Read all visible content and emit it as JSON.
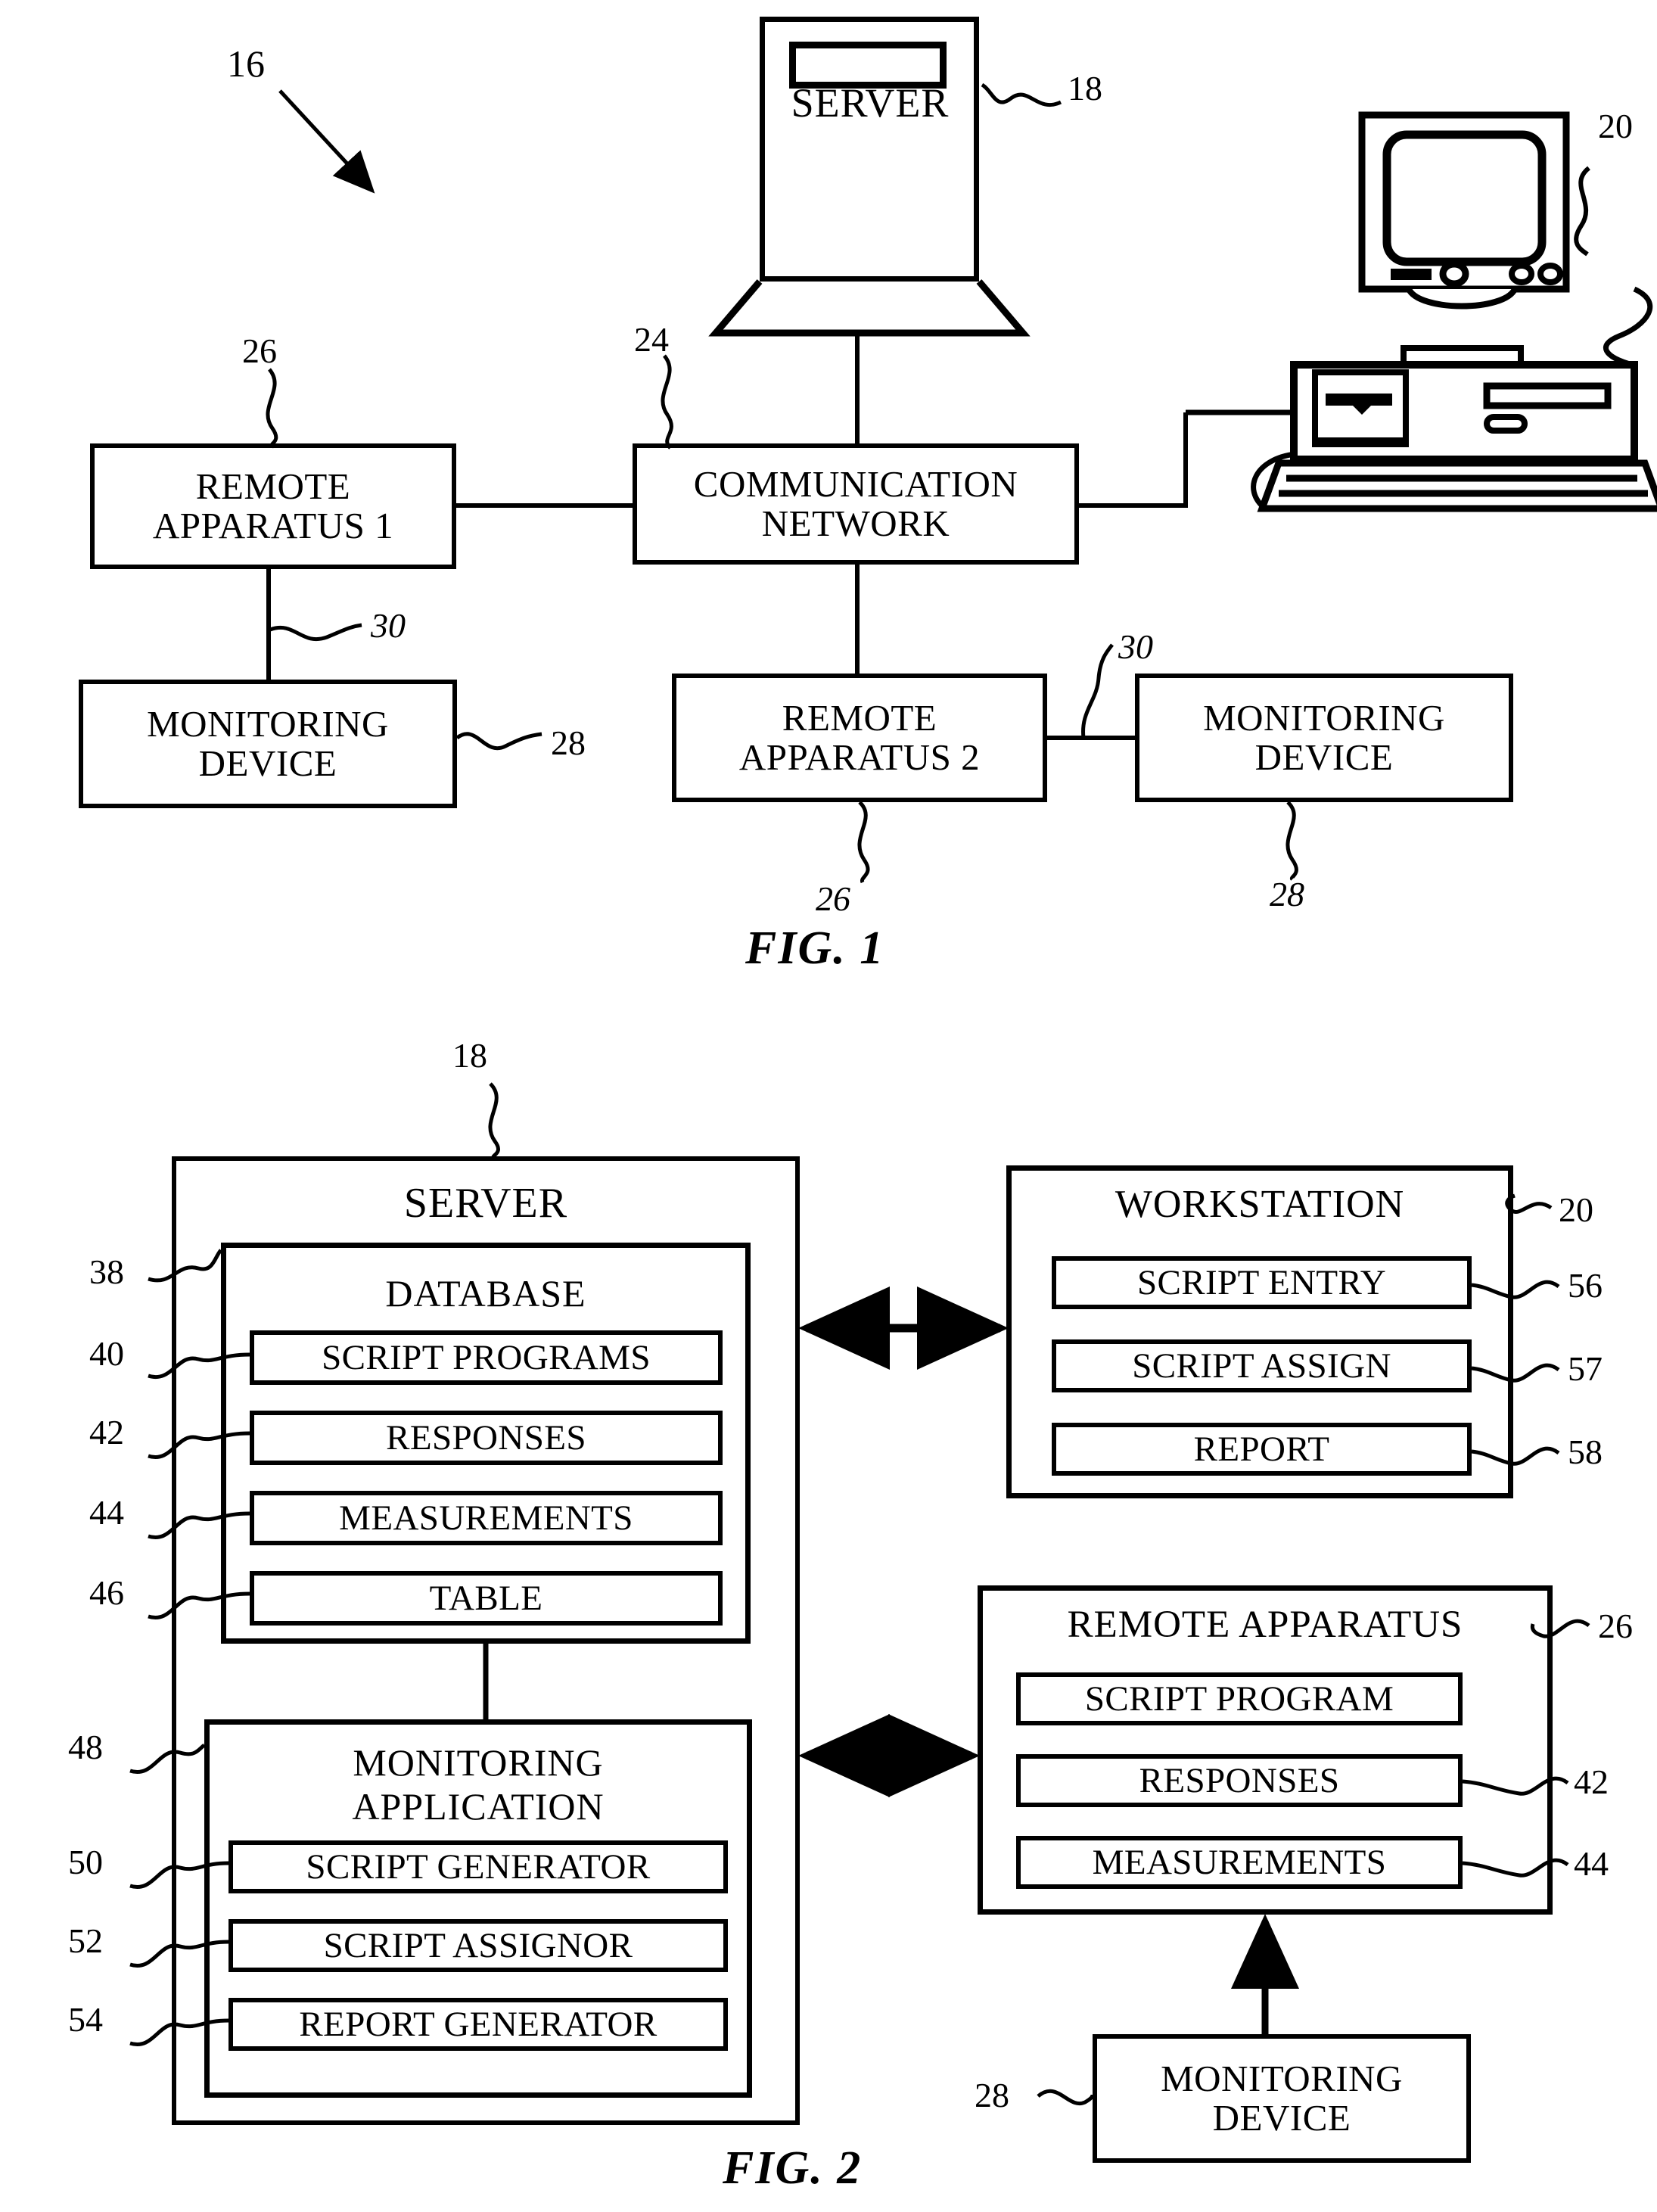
{
  "figure1": {
    "caption": "FIG. 1",
    "system_ref": "16",
    "nodes": {
      "server": {
        "label": "SERVER",
        "ref": "18"
      },
      "workstation_computer": {
        "ref": "20",
        "icon": "desktop-computer-illustration"
      },
      "communication_network": {
        "line1": "COMMUNICATION",
        "line2": "NETWORK",
        "ref": "24"
      },
      "remote_apparatus_1": {
        "line1": "REMOTE",
        "line2": "APPARATUS 1",
        "ref": "26"
      },
      "remote_apparatus_2": {
        "line1": "REMOTE",
        "line2": "APPARATUS 2",
        "ref": "26"
      },
      "monitoring_device_left": {
        "line1": "MONITORING",
        "line2": "DEVICE",
        "ref": "28"
      },
      "monitoring_device_right": {
        "line1": "MONITORING",
        "line2": "DEVICE",
        "ref": "28"
      }
    },
    "link_refs": {
      "link_left": "30",
      "link_right": "30"
    }
  },
  "figure2": {
    "caption": "FIG. 2",
    "server": {
      "title": "SERVER",
      "ref": "18",
      "database": {
        "title": "DATABASE",
        "ref": "38",
        "items": [
          {
            "label": "SCRIPT PROGRAMS",
            "ref": "40"
          },
          {
            "label": "RESPONSES",
            "ref": "42"
          },
          {
            "label": "MEASUREMENTS",
            "ref": "44"
          },
          {
            "label": "TABLE",
            "ref": "46"
          }
        ]
      },
      "monitoring_application": {
        "title_line1": "MONITORING",
        "title_line2": "APPLICATION",
        "ref": "48",
        "items": [
          {
            "label": "SCRIPT GENERATOR",
            "ref": "50"
          },
          {
            "label": "SCRIPT ASSIGNOR",
            "ref": "52"
          },
          {
            "label": "REPORT GENERATOR",
            "ref": "54"
          }
        ]
      }
    },
    "workstation": {
      "title": "WORKSTATION",
      "ref": "20",
      "items": [
        {
          "label": "SCRIPT ENTRY",
          "ref": "56"
        },
        {
          "label": "SCRIPT ASSIGN",
          "ref": "57"
        },
        {
          "label": "REPORT",
          "ref": "58"
        }
      ]
    },
    "remote_apparatus": {
      "title": "REMOTE APPARATUS",
      "ref": "26",
      "items": [
        {
          "label": "SCRIPT PROGRAM",
          "ref": ""
        },
        {
          "label": "RESPONSES",
          "ref": "42"
        },
        {
          "label": "MEASUREMENTS",
          "ref": "44"
        }
      ]
    },
    "monitoring_device": {
      "line1": "MONITORING",
      "line2": "DEVICE",
      "ref": "28"
    }
  },
  "colors": {
    "ink": "#000000",
    "paper": "#ffffff"
  }
}
